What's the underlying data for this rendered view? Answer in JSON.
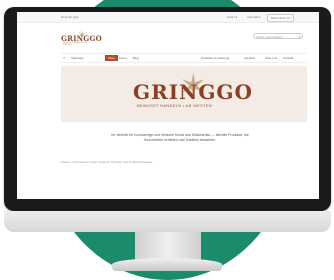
{
  "topbar": {
    "language": "Deutsch (gw)",
    "account": "Konto ▾",
    "user": "Anmelden",
    "cart": "Warenkorb (0)"
  },
  "logo": {
    "name": "GRINGGO",
    "tagline": "BEWUSST HANDELN • AB WESTEN"
  },
  "search": {
    "placeholder": "Suche nach Artikeln"
  },
  "nav": {
    "items": [
      "Startseite",
      "Shop",
      "Kunst",
      "Blog"
    ],
    "active_index": 1,
    "right_items": [
      "Produkte & Lieferung",
      "Versand",
      "Über uns",
      "Kontakt"
    ]
  },
  "hero": {
    "title": "GRINGGO",
    "tagline": "BEWUSST HANDELN • AB WESTEN"
  },
  "description": "Ihr Vertrieb für hochwertige und ethische Kunst aus Südamerika — stilvolle Produkte, die Geschichten erzählen und Tradition bewahren.",
  "more_text": "Weitere Informationen über Herkunft, Künstler und Produktionsweise"
}
